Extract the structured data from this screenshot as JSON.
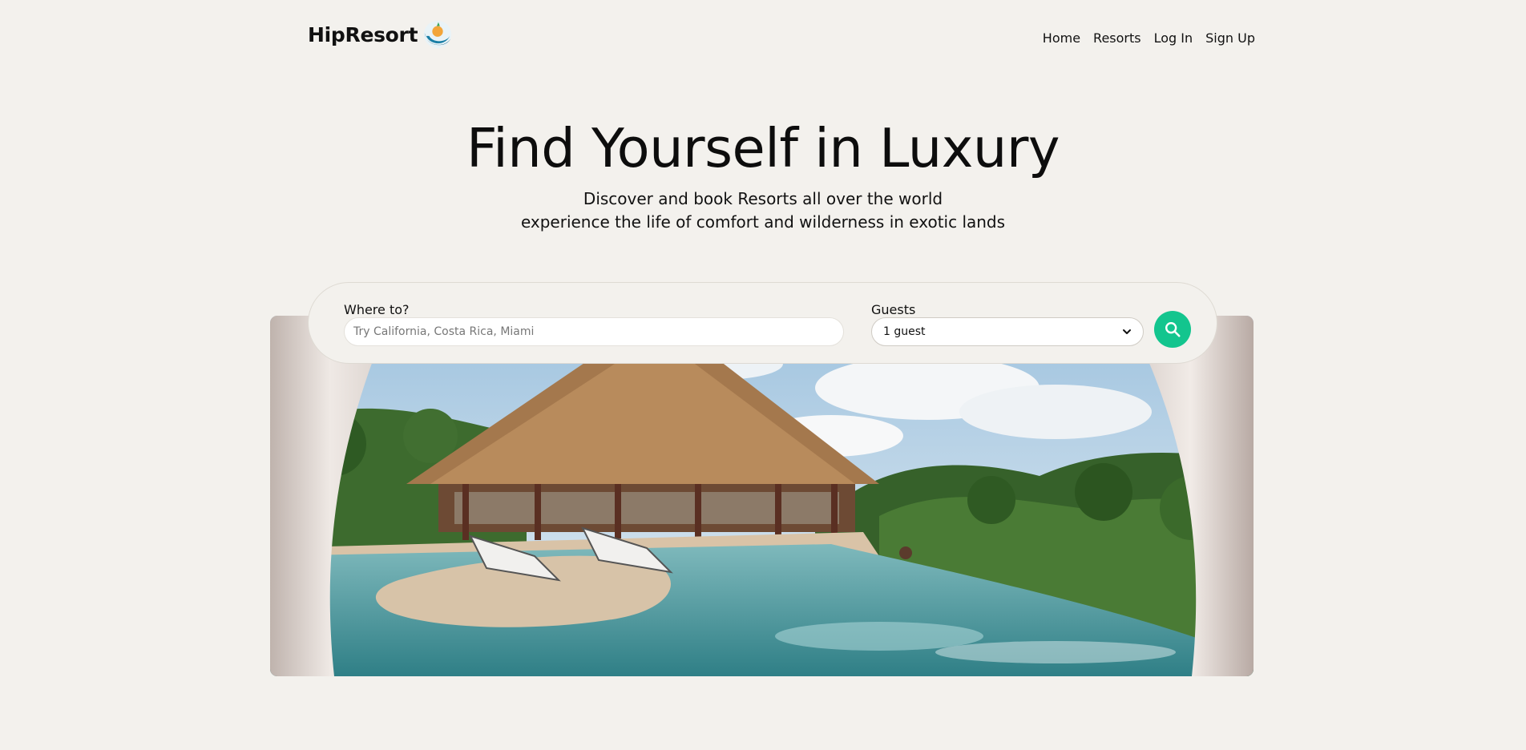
{
  "brand": {
    "name": "HipResort",
    "logo_icon": "wave-sun-icon"
  },
  "nav": {
    "items": [
      {
        "label": "Home"
      },
      {
        "label": "Resorts"
      },
      {
        "label": "Log In"
      },
      {
        "label": "Sign Up"
      }
    ]
  },
  "hero": {
    "title": "Find Yourself in Luxury",
    "subtitle_line1": "Discover and book Resorts all over the world",
    "subtitle_line2": "experience the life of comfort and wilderness in exotic lands",
    "image": "resort-infinity-pool-jungle-photo"
  },
  "search": {
    "where_label": "Where to?",
    "where_value": "",
    "where_placeholder": "Try California, Costa Rica, Miami",
    "guests_label": "Guests",
    "guests_selected": "1 guest",
    "search_icon": "search-icon"
  },
  "colors": {
    "background": "#f3f1ed",
    "accent": "#13c58e"
  }
}
